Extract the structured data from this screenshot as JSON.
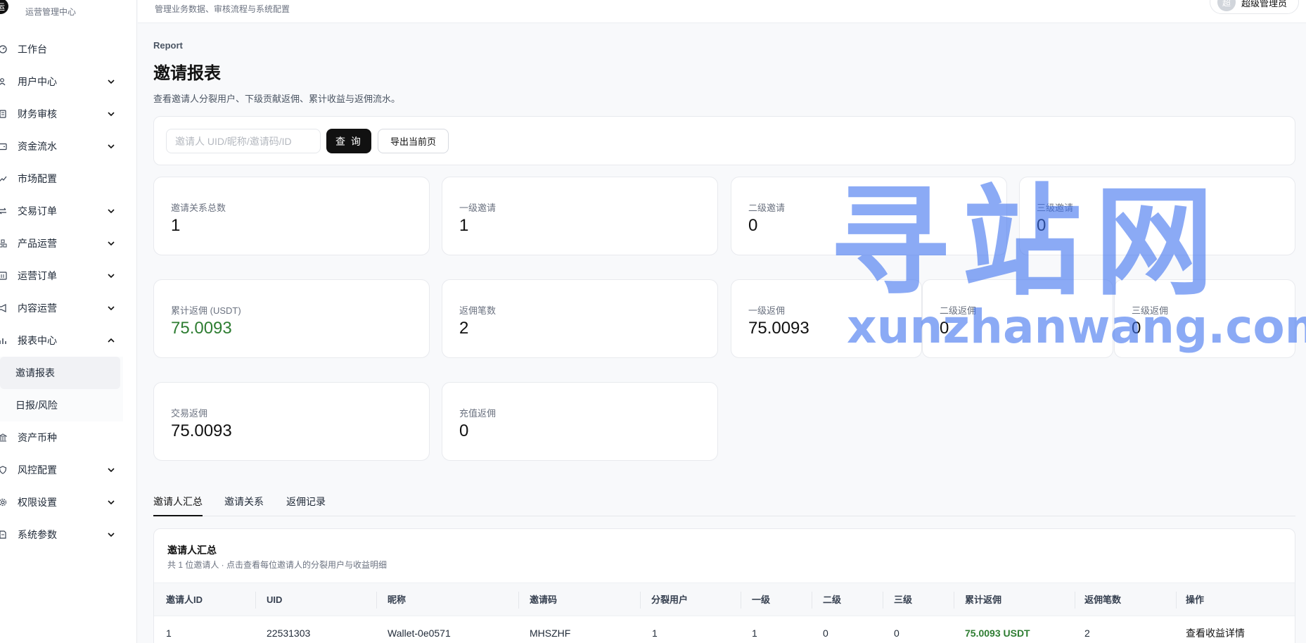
{
  "brand": {
    "logo": "运",
    "subtitle": "运营管理中心"
  },
  "header": {
    "description": "管理业务数据、审核流程与系统配置",
    "user_avatar": "超",
    "user_name": "超级管理员"
  },
  "sidebar": {
    "items": [
      {
        "label": "工作台",
        "icon": "dashboard-icon",
        "expandable": false
      },
      {
        "label": "用户中心",
        "icon": "users-icon",
        "expandable": true
      },
      {
        "label": "财务审核",
        "icon": "audit-icon",
        "expandable": true
      },
      {
        "label": "资金流水",
        "icon": "wallet-icon",
        "expandable": true
      },
      {
        "label": "市场配置",
        "icon": "chart-line-icon",
        "expandable": false
      },
      {
        "label": "交易订单",
        "icon": "exchange-icon",
        "expandable": true
      },
      {
        "label": "产品运营",
        "icon": "cubes-icon",
        "expandable": true
      },
      {
        "label": "运营订单",
        "icon": "order-icon",
        "expandable": true
      },
      {
        "label": "内容运营",
        "icon": "megaphone-icon",
        "expandable": true
      },
      {
        "label": "报表中心",
        "icon": "bar-chart-icon",
        "expandable": true,
        "expanded": true
      },
      {
        "label": "资产币种",
        "icon": "bank-icon",
        "expandable": false
      },
      {
        "label": "风控配置",
        "icon": "shield-icon",
        "expandable": true
      },
      {
        "label": "权限设置",
        "icon": "gear-icon",
        "expandable": true
      },
      {
        "label": "系统参数",
        "icon": "document-icon",
        "expandable": true
      }
    ],
    "report_children": [
      "邀请报表",
      "日报/风险"
    ]
  },
  "page": {
    "eyebrow": "Report",
    "title": "邀请报表",
    "description": "查看邀请人分裂用户、下级贡献返佣、累计收益与返佣流水。"
  },
  "filter": {
    "search_placeholder": "邀请人 UID/昵称/邀请码/ID",
    "query_label": "查 询",
    "export_label": "导出当前页"
  },
  "stats": [
    {
      "label": "邀请关系总数",
      "value": "1"
    },
    {
      "label": "一级邀请",
      "value": "1"
    },
    {
      "label": "二级邀请",
      "value": "0"
    },
    {
      "label": "三级邀请",
      "value": "0"
    },
    {
      "label": "累计返佣 (USDT)",
      "value": "75.0093"
    },
    {
      "label": "返佣笔数",
      "value": "2"
    },
    {
      "label": "一级返佣",
      "value": "75.0093"
    },
    {
      "label": "二级返佣",
      "value": "0"
    },
    {
      "label": "三级返佣",
      "value": "0"
    },
    {
      "label": "交易返佣",
      "value": "75.0093"
    },
    {
      "label": "充值返佣",
      "value": "0"
    }
  ],
  "tabs": [
    "邀请人汇总",
    "邀请关系",
    "返佣记录"
  ],
  "table": {
    "title": "邀请人汇总",
    "subtitle": "共 1 位邀请人 · 点击查看每位邀请人的分裂用户与收益明细",
    "columns": [
      "邀请人ID",
      "UID",
      "昵称",
      "邀请码",
      "分裂用户",
      "一级",
      "二级",
      "三级",
      "累计返佣",
      "返佣笔数",
      "操作"
    ],
    "rows": [
      [
        "1",
        "22531303",
        "Wallet-0e0571",
        "MHSZHF",
        "1",
        "1",
        "0",
        "0",
        "75.0093 USDT",
        "2",
        "查看收益详情"
      ]
    ]
  },
  "watermark": {
    "cn": "寻站网",
    "en": "xunzhanwang.com"
  },
  "colors": {
    "accent": "#111111",
    "positive": "#2e7d32",
    "watermark": "#3f73f0"
  }
}
